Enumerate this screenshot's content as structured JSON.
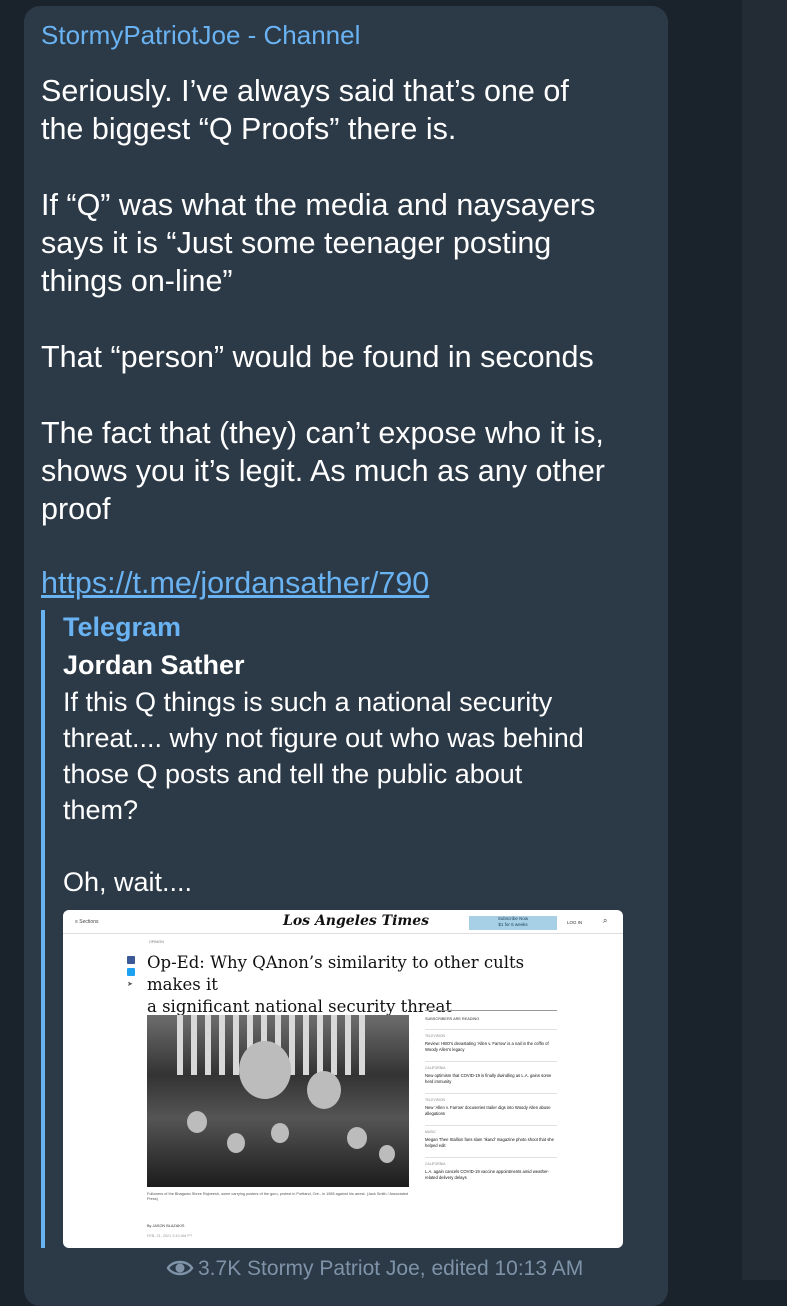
{
  "post": {
    "channel_name": "StormyPatriotJoe - Channel",
    "paragraphs": [
      [
        "Seriously.  I’ve always said that’s one of",
        "the biggest “Q Proofs” there is."
      ],
      [
        "If “Q” was what the media and naysayers",
        "says it is “Just some teenager posting",
        "things on-line”"
      ],
      [
        "That “person” would be found in seconds"
      ],
      [
        "The fact that (they) can’t expose who it is,",
        "shows you it’s legit.  As much as any other",
        "proof"
      ]
    ],
    "link": "https://t.me/jordansather/790"
  },
  "preview": {
    "site_name": "Telegram",
    "title": "Jordan Sather",
    "description_lines": [
      "If this Q things is such a national security",
      "threat.... why not figure out who was behind",
      "those Q posts and tell the public about",
      "them?"
    ],
    "description_tail": "Oh, wait...."
  },
  "article": {
    "sections": "≡ Sections",
    "logo": "Los Angeles Times",
    "subscribe": "Subscribe Now",
    "subscribe_sub": "$1 for 6 weeks",
    "login": "LOG IN",
    "kicker": "OPINION",
    "headline_1": "Op-Ed: Why QAnon’s similarity to other cults makes it",
    "headline_2": "a significant national security threat",
    "caption": "Followers of the Bhagwan Shree Rajneesh, some carrying posters of the guru, protest in Portland, Ore., in 1985 against his arrest. (Jack Smith / Associated Press)",
    "byline": "By JASON BLAZAKIS",
    "date": "FEB. 21, 2021 3:10 AM PT",
    "rail_heading": "SUBSCRIBERS ARE READING",
    "rail_items": [
      {
        "cat": "TELEVISION",
        "text": "Review: HBO’s devastating ‘Allen v. Farrow’ is a nail in the coffin of Woody Allen’s legacy"
      },
      {
        "cat": "CALIFORNIA",
        "text": "New optimism that COVID-19 is finally dwindling as L.A. gains some herd immunity"
      },
      {
        "cat": "TELEVISION",
        "text": "New ‘Allen v. Farrow’ docuseries trailer digs into Woody Allen abuse allegations"
      },
      {
        "cat": "MUSIC",
        "text": "Megan Thee Stallion fans slam ‘Ikand’ magazine photo shoot that she helped edit"
      },
      {
        "cat": "CALIFORNIA",
        "text": "L.A. again cancels COVID-19 vaccine appointments amid weather-related delivery delays"
      }
    ]
  },
  "footer": {
    "views": "3.7K",
    "author_edited": "Stormy Patriot Joe, edited 10:13 AM",
    "icon": "eye-icon"
  }
}
